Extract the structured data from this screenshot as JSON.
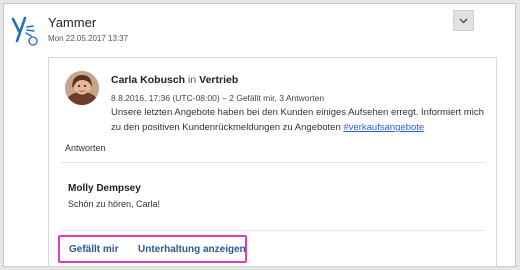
{
  "header": {
    "title": "Yammer",
    "date": "Mon 22.05.2017 13:37",
    "logo_icon": "yammer-logo-icon",
    "collapse_icon": "chevron-down-icon"
  },
  "post": {
    "author": "Carla Kobusch",
    "in_word": "in",
    "group": "Vertrieb",
    "meta": "8.8.2016, 17:36 (UTC-08:00) – 2 Gefällt mir, 3 Antworten",
    "body": "Unsere letzten Angebote haben bei den Kunden einiges Aufsehen erregt. Informiert mich zu den positiven Kundenrückmeldungen zu Angeboten ",
    "hashtag": "#verkaufsangebote",
    "reply_label": "Antworten"
  },
  "reply": {
    "author": "Molly Dempsey",
    "text": "Schön zu hören, Carla!"
  },
  "actions": {
    "like": "Gefällt mir",
    "view_conversation": "Unterhaltung anzeigen"
  },
  "colors": {
    "link": "#2b5797",
    "hashtag": "#2b5fd6",
    "highlight": "#e23bb4",
    "logo": "#1e6fc2"
  }
}
